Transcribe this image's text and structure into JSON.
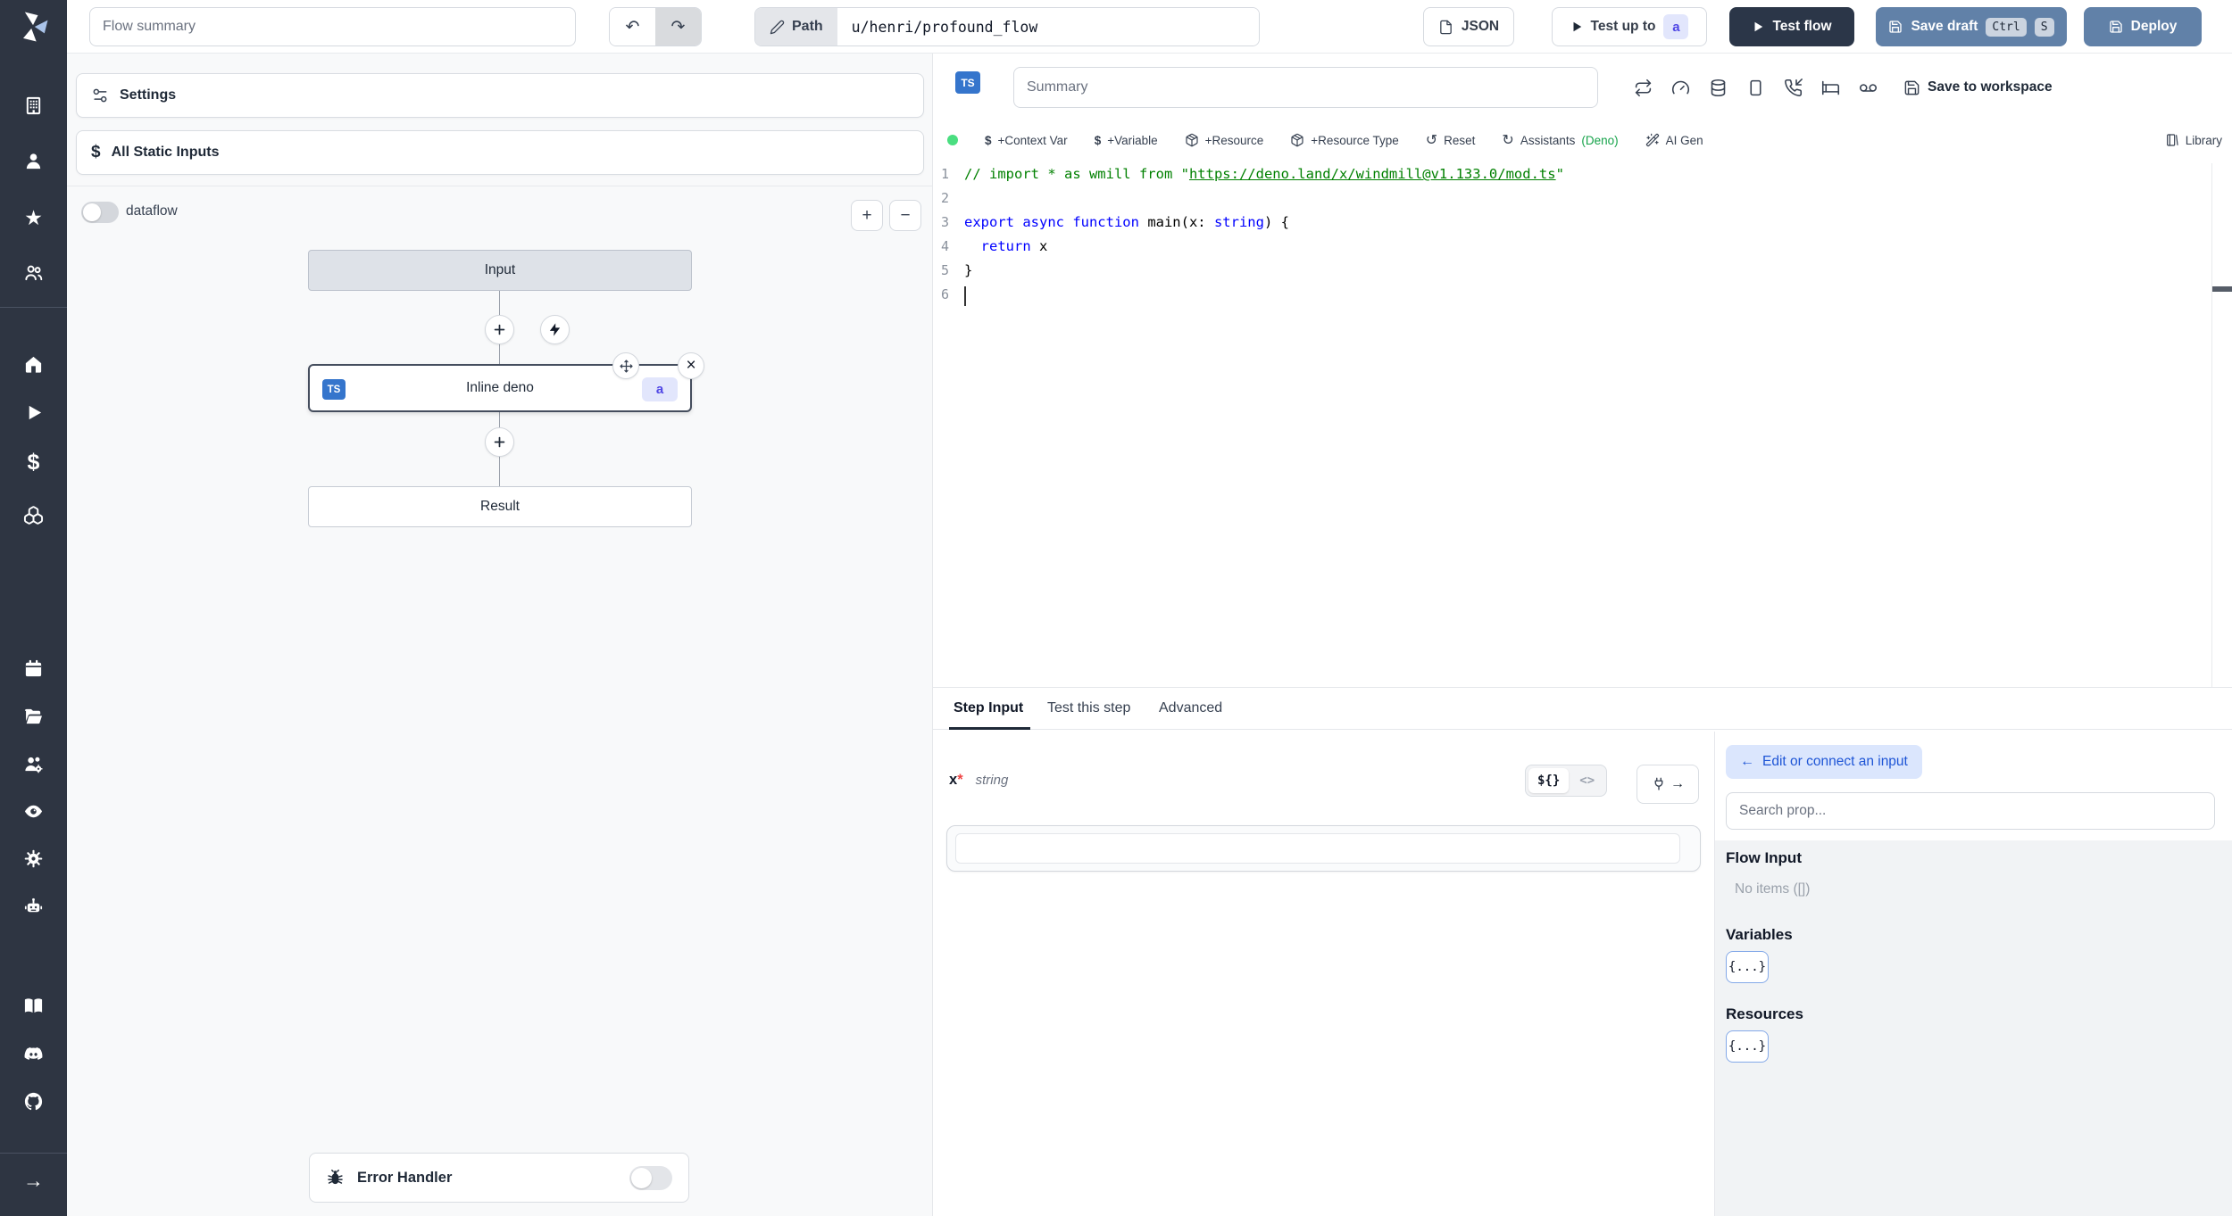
{
  "colors": {
    "sidebar_bg": "#2e3542",
    "dark_button": "#2b3648",
    "primary_button": "#6181a8",
    "ts_badge_blue": "#3575cc",
    "badge_indigo_bg": "#e2e6fc",
    "badge_indigo_text": "#4f46e5",
    "success_green": "#4ade80",
    "assistants_green": "#16a34a",
    "comment_green": "#008000",
    "keyword_blue": "#0000ff",
    "edit_input_button_bg": "#dbe6fd",
    "edit_input_button_text": "#1e55d6"
  },
  "icons": {
    "undo": "↶",
    "redo": "↷",
    "close": "×",
    "arrow_left": "←",
    "sidebar_arrow": "→",
    "plug_arrow": "→",
    "reset": "↺",
    "refresh": "↻",
    "star": "★",
    "dollar": "$",
    "plus": "+",
    "minus": "−"
  },
  "topbar": {
    "flow_summary_placeholder": "Flow summary",
    "path_label": "Path",
    "path_value": "u/henri/profound_flow",
    "json_label": "JSON",
    "test_up_to_label": "Test up to",
    "test_up_to_badge": "a",
    "test_flow_label": "Test flow",
    "save_draft_label": "Save draft",
    "save_draft_kbd": [
      "Ctrl",
      "S"
    ],
    "deploy_label": "Deploy"
  },
  "flow_panel": {
    "settings_label": "Settings",
    "all_static_inputs_label": "All Static Inputs",
    "dataflow_label": "dataflow",
    "nodes": {
      "input_label": "Input",
      "step_label": "Inline deno",
      "step_lang_badge": "TS",
      "step_id_badge": "a",
      "result_label": "Result"
    },
    "error_handler_label": "Error Handler"
  },
  "editor": {
    "lang_badge": "TS",
    "summary_placeholder": "Summary",
    "save_to_workspace_label": "Save to workspace",
    "toolbar": {
      "dollar": "$",
      "context_var": "+Context Var",
      "variable": "+Variable",
      "resource": "+Resource",
      "resource_type": "+Resource Type",
      "reset": "Reset",
      "assistants": "Assistants",
      "assistants_lang": "(Deno)",
      "ai_gen": "AI Gen",
      "library": "Library"
    },
    "code": {
      "line_numbers": [
        "1",
        "2",
        "3",
        "4",
        "5",
        "6"
      ],
      "l1_comment": "// import * as wmill from \"",
      "l1_url": "https://deno.land/x/windmill@v1.133.0/mod.ts",
      "l1_close": "\"",
      "l3_kw": "export async function ",
      "l3_name": "main",
      "l3_punct1": "(x: ",
      "l3_type": "string",
      "l3_punct2": ") {",
      "l4_kw": "  return",
      "l4_rest": " x",
      "l5_brace": "}"
    }
  },
  "step_panel": {
    "tabs": [
      "Step Input",
      "Test this step",
      "Advanced"
    ],
    "field": {
      "name": "x",
      "required": "*",
      "type": "string"
    },
    "toggle_template": "${}",
    "toggle_code": "<>",
    "input_value": ""
  },
  "connect_panel": {
    "edit_button_label": "Edit or connect an input",
    "search_placeholder": "Search prop...",
    "flow_input_title": "Flow Input",
    "flow_input_empty": "No items ([])",
    "variables_title": "Variables",
    "variables_chip": "{...}",
    "resources_title": "Resources",
    "resources_chip": "{...}"
  }
}
